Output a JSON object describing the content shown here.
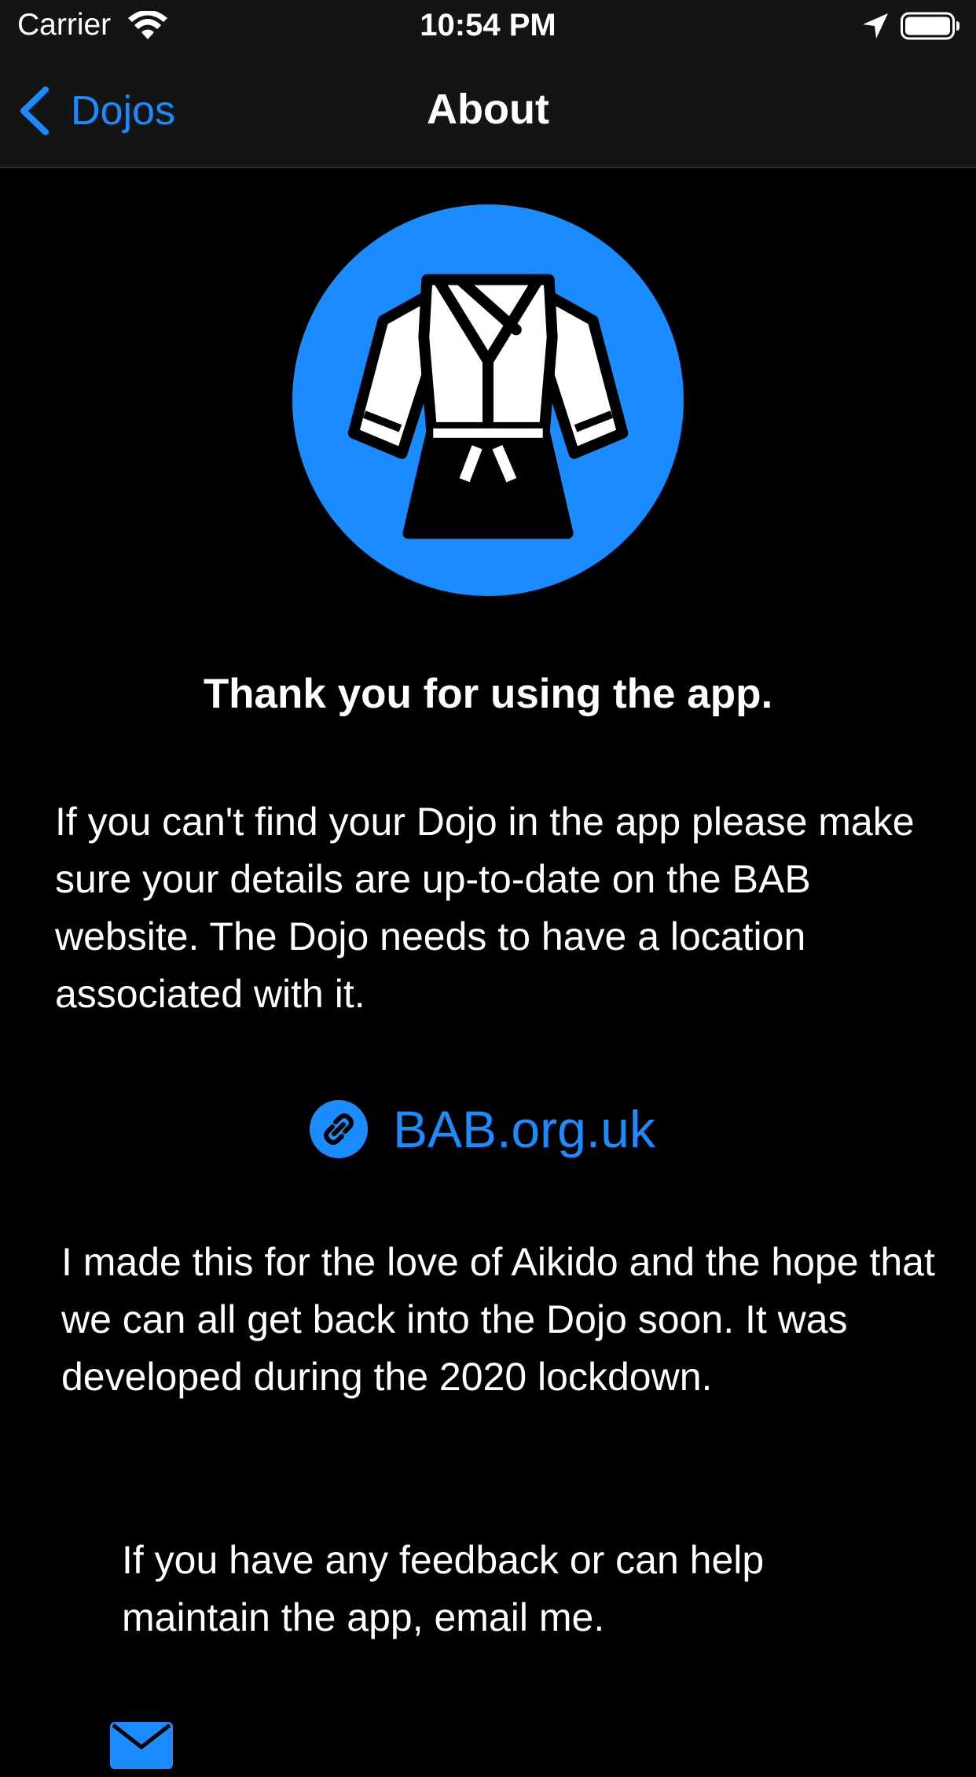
{
  "status_bar": {
    "carrier": "Carrier",
    "time": "10:54 PM"
  },
  "nav": {
    "back_label": "Dojos",
    "title": "About"
  },
  "content": {
    "thank_you": "Thank you for using the app.",
    "paragraph_1": "If you can't find your Dojo in the app please make sure your details are up-to-date on the BAB website. The Dojo needs to have a location associated with it.",
    "website_link": "BAB.org.uk",
    "paragraph_2": "I made this for the love of Aikido and the hope that we can all get back into the Dojo soon. It was developed during the 2020 lockdown.",
    "paragraph_3": "If you have any feedback or can help maintain the app, email me."
  },
  "colors": {
    "accent": "#1a8cff",
    "background": "#000000",
    "bar_background": "#141414",
    "text": "#ffffff"
  },
  "icons": {
    "logo": "karate-gi-icon",
    "link": "link-icon",
    "email": "envelope-icon",
    "back": "chevron-left-icon"
  }
}
